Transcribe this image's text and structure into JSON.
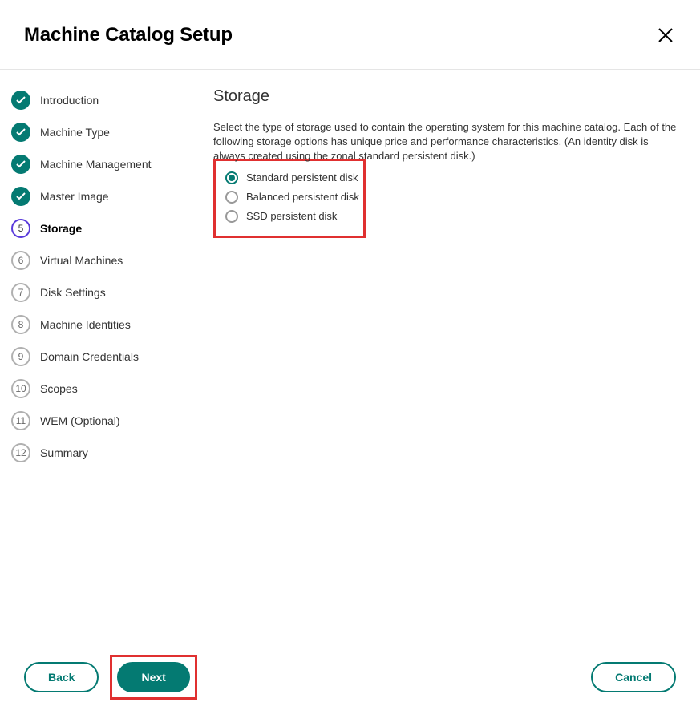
{
  "header": {
    "title": "Machine Catalog Setup"
  },
  "sidebar": {
    "steps": [
      {
        "label": "Introduction",
        "state": "done",
        "num": ""
      },
      {
        "label": "Machine Type",
        "state": "done",
        "num": ""
      },
      {
        "label": "Machine Management",
        "state": "done",
        "num": ""
      },
      {
        "label": "Master Image",
        "state": "done",
        "num": ""
      },
      {
        "label": "Storage",
        "state": "current",
        "num": "5"
      },
      {
        "label": "Virtual Machines",
        "state": "pending",
        "num": "6"
      },
      {
        "label": "Disk Settings",
        "state": "pending",
        "num": "7"
      },
      {
        "label": "Machine Identities",
        "state": "pending",
        "num": "8"
      },
      {
        "label": "Domain Credentials",
        "state": "pending",
        "num": "9"
      },
      {
        "label": "Scopes",
        "state": "pending",
        "num": "10"
      },
      {
        "label": "WEM (Optional)",
        "state": "pending",
        "num": "11"
      },
      {
        "label": "Summary",
        "state": "pending",
        "num": "12"
      }
    ]
  },
  "main": {
    "heading": "Storage",
    "description": "Select the type of storage used to contain the operating system for this machine catalog. Each of the following storage options has unique price and performance characteristics. (An identity disk is always created using the zonal standard persistent disk.)",
    "options": [
      {
        "label": "Standard persistent disk",
        "selected": true
      },
      {
        "label": "Balanced persistent disk",
        "selected": false
      },
      {
        "label": "SSD persistent disk",
        "selected": false
      }
    ]
  },
  "footer": {
    "back": "Back",
    "next": "Next",
    "cancel": "Cancel"
  }
}
